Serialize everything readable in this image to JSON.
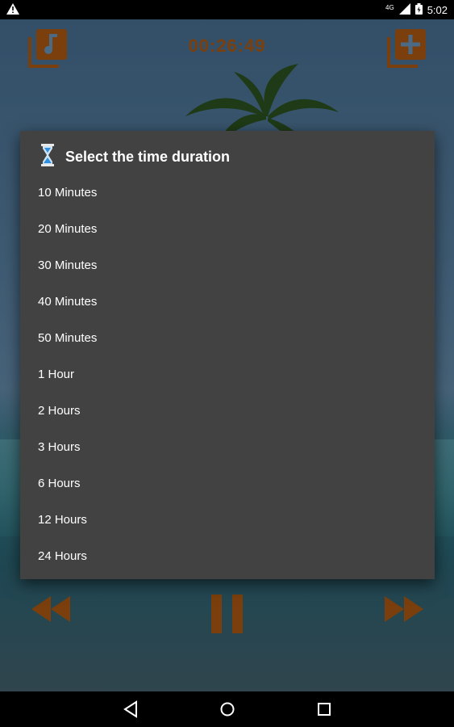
{
  "status_bar": {
    "network": "4G",
    "time": "5:02"
  },
  "player": {
    "timer": "00:26:49"
  },
  "dialog": {
    "title": "Select the time duration",
    "options": [
      "10 Minutes",
      "20 Minutes",
      "30 Minutes",
      "40 Minutes",
      "50 Minutes",
      "1 Hour",
      "2 Hours",
      "3 Hours",
      "6 Hours",
      "12 Hours",
      "24 Hours"
    ]
  },
  "colors": {
    "accent": "#7a3f0c",
    "dialog_bg": "#424242"
  }
}
